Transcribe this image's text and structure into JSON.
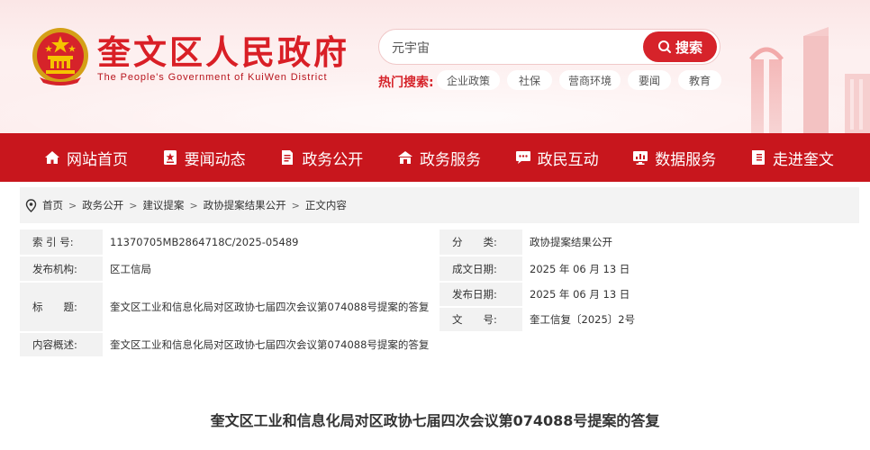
{
  "header": {
    "title": "奎文区人民政府",
    "subtitle": "The People's Government of KuiWen District",
    "search": {
      "value": "元宇宙",
      "button_label": "搜索"
    },
    "hot_label": "热门搜索:",
    "hot_tags": [
      "企业政策",
      "社保",
      "营商环境",
      "要闻",
      "教育"
    ]
  },
  "nav": {
    "items": [
      {
        "label": "网站首页",
        "icon": "home-icon"
      },
      {
        "label": "要闻动态",
        "icon": "news-icon"
      },
      {
        "label": "政务公开",
        "icon": "document-icon"
      },
      {
        "label": "政务服务",
        "icon": "service-icon"
      },
      {
        "label": "政民互动",
        "icon": "chat-icon"
      },
      {
        "label": "数据服务",
        "icon": "monitor-icon"
      },
      {
        "label": "走进奎文",
        "icon": "book-icon"
      }
    ]
  },
  "breadcrumb": [
    "首页",
    "政务公开",
    "建议提案",
    "政协提案结果公开",
    "正文内容"
  ],
  "meta": {
    "index_label": "索 引 号:",
    "index_value": "11370705MB2864718C/2025-05489",
    "category_label": "分　　类:",
    "category_value": "政协提案结果公开",
    "publisher_label": "发布机构:",
    "publisher_value": "区工信局",
    "created_label": "成文日期:",
    "created_value": "2025 年 06 月 13 日",
    "title_label": "标　　题:",
    "title_value": "奎文区工业和信息化局对区政协七届四次会议第074088号提案的答复",
    "published_label": "发布日期:",
    "published_value": "2025 年 06 月 13 日",
    "docno_label": "文　　号:",
    "docno_value": "奎工信复〔2025〕2号",
    "summary_label": "内容概述:",
    "summary_value": "奎文区工业和信息化局对区政协七届四次会议第074088号提案的答复"
  },
  "article": {
    "title": "奎文区工业和信息化局对区政协七届四次会议第074088号提案的答复"
  },
  "colors": {
    "brand_red": "#c8161d",
    "title_red": "#d91f26"
  }
}
